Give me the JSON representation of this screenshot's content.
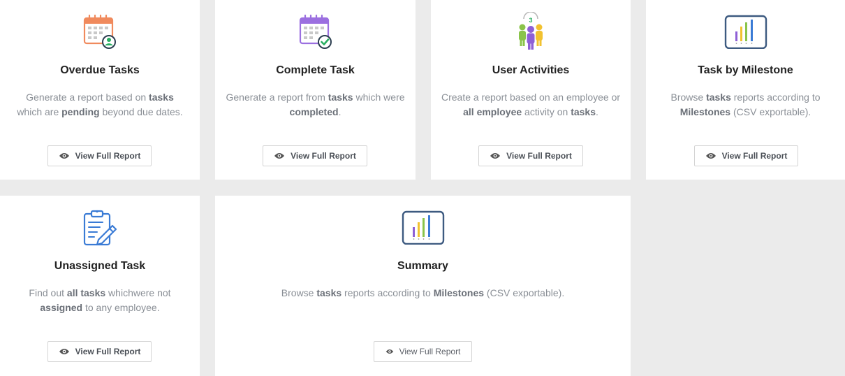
{
  "cards": [
    {
      "title": "Overdue Tasks",
      "desc": [
        "Generate a report based on ",
        "tasks",
        " which are ",
        "pending",
        " beyond due dates."
      ],
      "button": "View Full Report",
      "icon": "calendar-user-icon"
    },
    {
      "title": "Complete Task",
      "desc": [
        "Generate a report from ",
        "tasks",
        " which were ",
        "completed",
        "."
      ],
      "button": "View Full Report",
      "icon": "calendar-check-icon"
    },
    {
      "title": "User Activities",
      "desc": [
        "Create a report based on an employee or ",
        "all employee",
        " activity on ",
        "tasks",
        "."
      ],
      "button": "View Full Report",
      "icon": "users-group-icon",
      "badge": "3"
    },
    {
      "title": "Task by Milestone",
      "desc": [
        "Browse ",
        "tasks",
        " reports according to ",
        "Milestones",
        " (CSV exportable)."
      ],
      "button": "View Full Report",
      "icon": "bar-chart-icon"
    },
    {
      "title": "Unassigned Task",
      "desc": [
        "Find out ",
        "all tasks",
        " whichwere not ",
        "assigned",
        " to any employee."
      ],
      "button": "View Full Report",
      "icon": "clipboard-edit-icon"
    },
    {
      "title": "Summary",
      "desc": [
        "Browse ",
        "tasks",
        " reports according to ",
        "Milestones",
        " (CSV exportable)."
      ],
      "button": "View Full Report",
      "icon": "bar-chart-icon"
    }
  ],
  "colors": {
    "background": "#ebebeb",
    "calendar_orange": "#f08a5d",
    "calendar_purple": "#9b6fe0",
    "check_green": "#27ae60",
    "chart_frame": "#3d5a80",
    "clipboard_blue": "#3a7bd5"
  }
}
